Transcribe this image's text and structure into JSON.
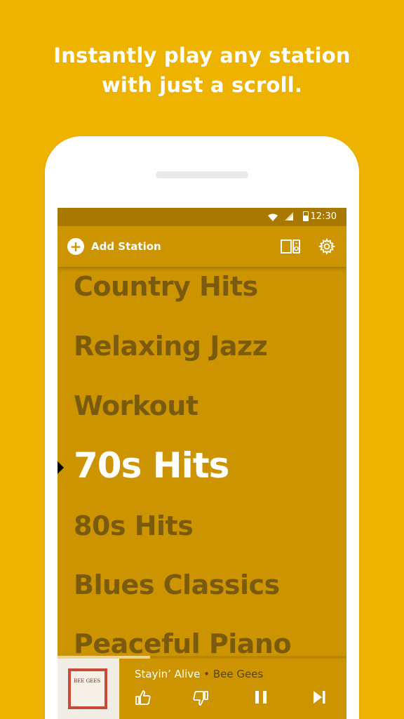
{
  "headline": {
    "line1": "Instantly play any station",
    "line2": "with just a scroll."
  },
  "status_bar": {
    "time": "12:30",
    "icons": [
      "wifi-icon",
      "signal-icon",
      "battery-icon"
    ]
  },
  "toolbar": {
    "add_station_label": "Add Station",
    "icons": [
      "plus-icon",
      "cast-icon",
      "gear-icon"
    ]
  },
  "stations": [
    {
      "label": "Country Hits",
      "active": false
    },
    {
      "label": "Relaxing Jazz",
      "active": false
    },
    {
      "label": "Workout",
      "active": false
    },
    {
      "label": "70s Hits",
      "active": true
    },
    {
      "label": "80s Hits",
      "active": false
    },
    {
      "label": "Blues Classics",
      "active": false
    },
    {
      "label": "Peaceful Piano",
      "active": false
    }
  ],
  "player": {
    "track_title": "Stayin’ Alive",
    "separator": "•",
    "artist": "Bee Gees",
    "album_art_text": "BEE GEES",
    "progress": 0.32,
    "controls": [
      "thumbs-up-icon",
      "thumbs-down-icon",
      "pause-icon",
      "skip-next-icon"
    ]
  },
  "colors": {
    "background": "#EDB300",
    "screen": "#CC9400",
    "status_bar": "#A87800",
    "inactive_text": "#7A5B0E",
    "active_text": "#FFFFFF"
  }
}
